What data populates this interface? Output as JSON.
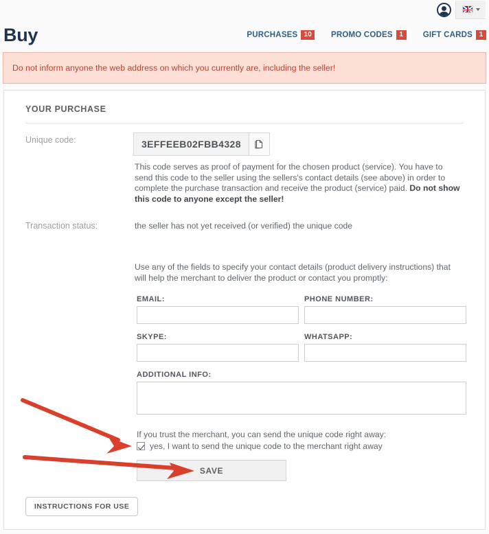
{
  "topbar": {
    "avatar_icon": "user-avatar-icon",
    "language_flag": "uk-flag-icon",
    "language_chevron": "chevron-down-icon"
  },
  "header": {
    "brand": "Buy",
    "nav": [
      {
        "label": "PURCHASES",
        "badge": "10"
      },
      {
        "label": "PROMO CODES",
        "badge": "1"
      },
      {
        "label": "GIFT CARDS",
        "badge": "1"
      }
    ]
  },
  "alert": {
    "text": "Do not inform anyone the web address on which you currently are, including the seller!"
  },
  "card": {
    "title": "YOUR PURCHASE",
    "unique_code_label": "Unique code:",
    "unique_code_value": "3EFFEEB02FBB4328",
    "copy_icon": "copy-icon",
    "code_description_1": "This code serves as proof of payment for the chosen product (service). You have to send this code to the seller using the sellers's contact details (see above) in order to complete the purchase transaction and receive the product (service) paid. ",
    "code_description_bold": "Do not show this code to anyone except the seller!",
    "transaction_status_label": "Transaction status:",
    "transaction_status_value": "the seller has not yet received (or verified) the unique code",
    "contact_intro": "Use any of the fields to specify your contact details (product delivery instructions) that will help the merchant to deliver the product or contact you promptly:",
    "fields": {
      "email_label": "EMAIL:",
      "email_value": "",
      "phone_label": "PHONE NUMBER:",
      "phone_value": "",
      "skype_label": "SKYPE:",
      "skype_value": "",
      "whatsapp_label": "WHATSAPP:",
      "whatsapp_value": "",
      "additional_label": "ADDITIONAL INFO:",
      "additional_value": ""
    },
    "trust_text": "If you trust the merchant, you can send the unique code right away:",
    "checkbox_label": "yes, I want to send the unique code to the merchant right away",
    "checkbox_checked": true,
    "save_label": "SAVE",
    "instructions_label": "INSTRUCTIONS FOR USE"
  },
  "annotations": {
    "arrow_color": "#d93f2b",
    "arrow_1_target": "send-code-checkbox",
    "arrow_2_target": "save-button"
  },
  "colors": {
    "brand_navy": "#1d3552",
    "nav_blue": "#2f5d86",
    "badge_red": "#d94a3d",
    "alert_bg": "#fbdfd6",
    "alert_border": "#e8b6a6",
    "alert_text": "#b9432a"
  }
}
